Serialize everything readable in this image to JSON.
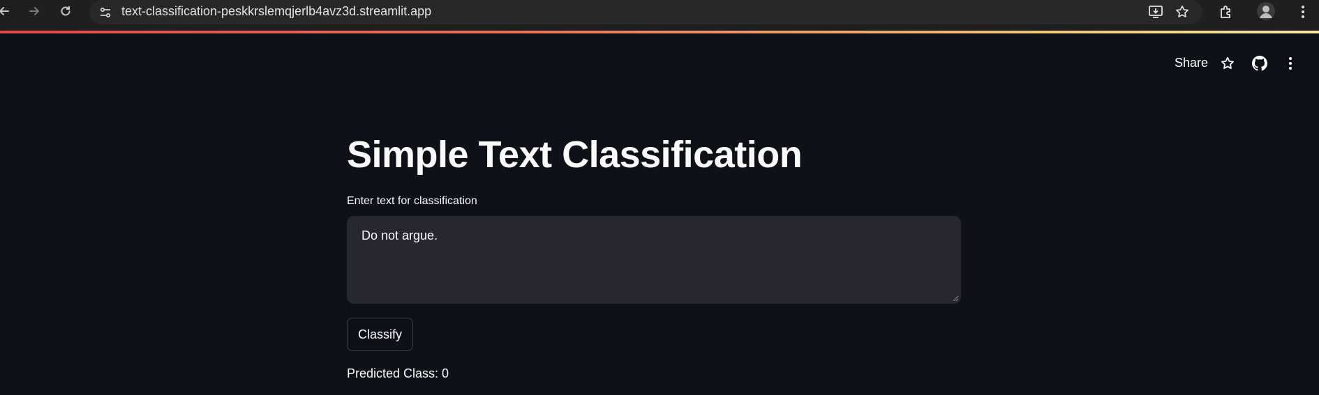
{
  "browser": {
    "url": "text-classification-peskkrslemqjerlb4avz3d.streamlit.app",
    "back_icon": "arrow-left-icon",
    "forward_icon": "arrow-right-icon",
    "reload_icon": "reload-icon"
  },
  "toolbar": {
    "share_label": "Share",
    "star_icon": "star-icon",
    "github_icon": "github-icon",
    "menu_icon": "vertical-dots-icon"
  },
  "main": {
    "title": "Simple Text Classification",
    "input_label": "Enter text for classification",
    "input_value": "Do not argue.",
    "classify_label": "Classify",
    "prediction_text": "Predicted Class: 0"
  },
  "colors": {
    "background": "#0e1117",
    "input_bg": "#262730",
    "text": "#fafafa",
    "accent_gradient_start": "#e24a4a",
    "accent_gradient_end": "#f5e6a8"
  }
}
